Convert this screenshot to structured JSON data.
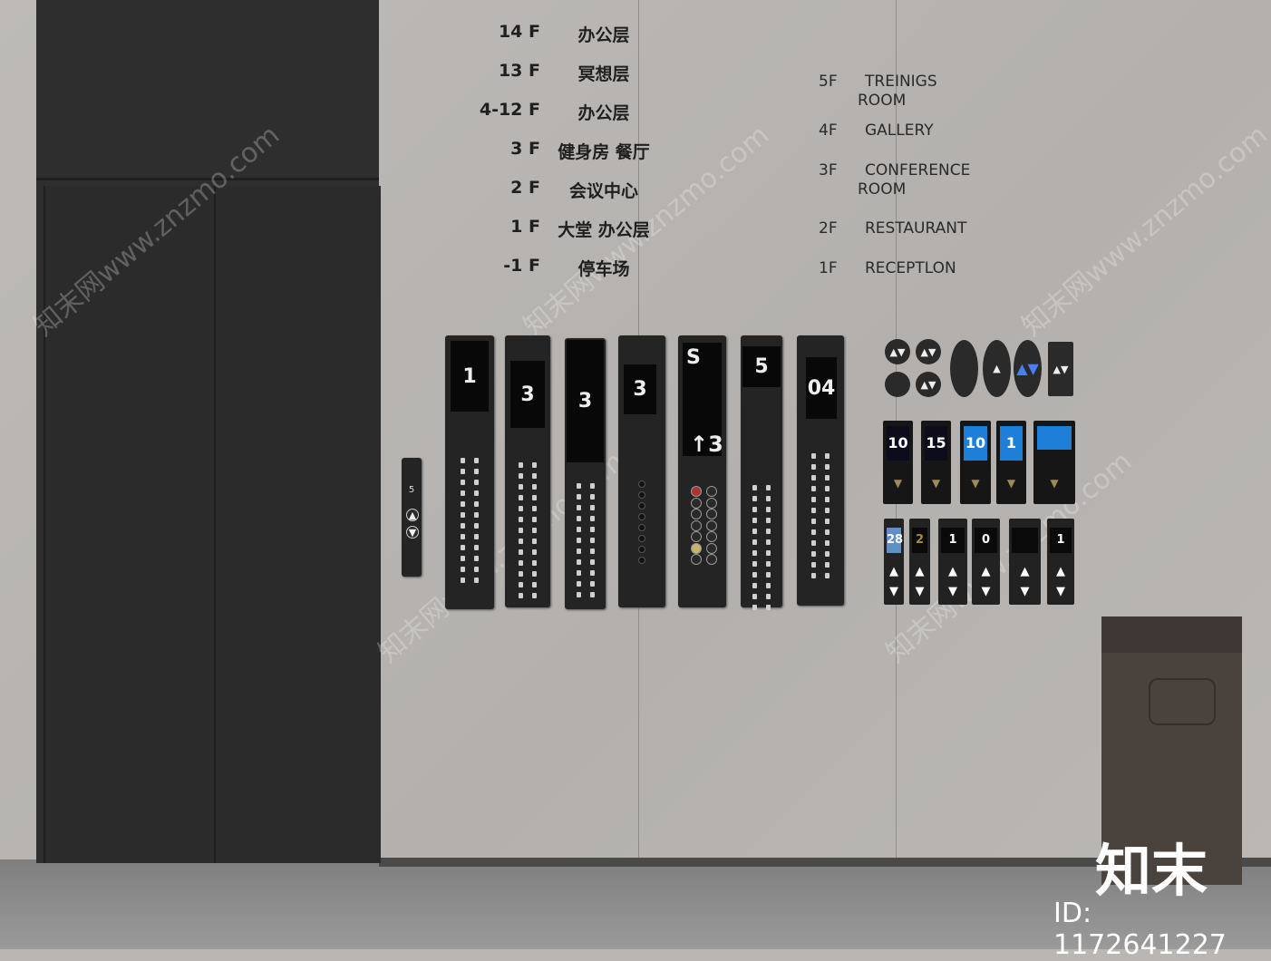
{
  "directory_cn": [
    {
      "floor": "14 F",
      "name": "办公层"
    },
    {
      "floor": "13 F",
      "name": "冥想层"
    },
    {
      "floor": "4-12 F",
      "name": "办公层"
    },
    {
      "floor": "3 F",
      "name": "健身房 餐厅"
    },
    {
      "floor": "2 F",
      "name": "会议中心"
    },
    {
      "floor": "1 F",
      "name": "大堂 办公层"
    },
    {
      "floor": "-1 F",
      "name": "停车场"
    }
  ],
  "directory_en": [
    {
      "floor": "5F",
      "name": "TREINIGS",
      "name2": "ROOM"
    },
    {
      "floor": "4F",
      "name": "GALLERY",
      "name2": ""
    },
    {
      "floor": "3F",
      "name": "CONFERENCE",
      "name2": "ROOM"
    },
    {
      "floor": "2F",
      "name": "RESTAURANT",
      "name2": ""
    },
    {
      "floor": "1F",
      "name": "RECEPTLON",
      "name2": ""
    }
  ],
  "panels": [
    {
      "display": "1"
    },
    {
      "display": "3"
    },
    {
      "display": "3"
    },
    {
      "display": "3"
    },
    {
      "display": "S"
    },
    {
      "display": "5"
    },
    {
      "display": "04"
    }
  ],
  "panels_extra": {
    "p5_lower": "↑3",
    "small_panel": "5"
  },
  "cards_row2": [
    "10",
    "15",
    "10",
    "1",
    ""
  ],
  "cards_row3": [
    "28",
    "2",
    "1",
    "0",
    "",
    "1"
  ],
  "watermark": {
    "brand": "知末",
    "id": "ID: 1172641227",
    "site": "知末网www.znzmo.com"
  },
  "colors": {
    "wall": "#b9b6b3",
    "elevator": "#2e2e2e",
    "panel": "#242424",
    "trash_can": "#4a423d",
    "accent_blue": "#4a7cff"
  }
}
